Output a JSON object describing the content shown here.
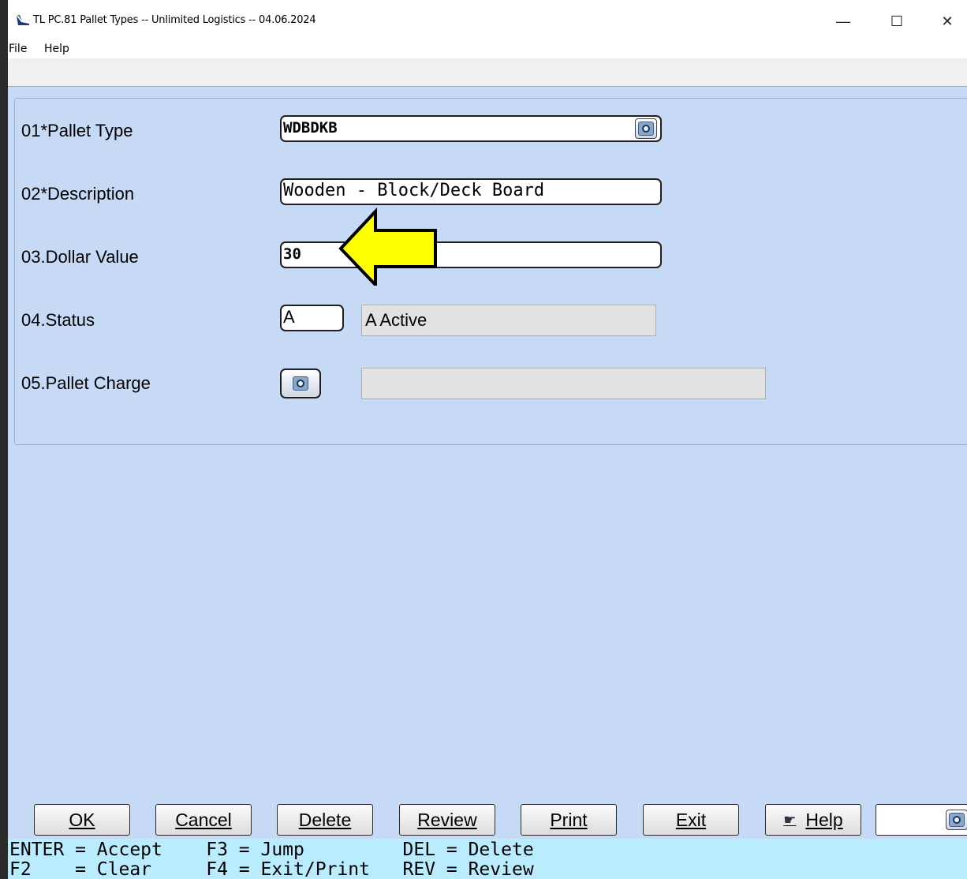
{
  "window": {
    "title": "TL PC.81 Pallet Types -- Unlimited Logistics -- 04.06.2024",
    "minimize_glyph": "—",
    "maximize_glyph": "☐",
    "close_glyph": "✕"
  },
  "menu": {
    "items": [
      "File",
      "Help"
    ]
  },
  "form": {
    "fields": [
      {
        "label": "01*Pallet Type",
        "value": "WDBDKB"
      },
      {
        "label": "02*Description",
        "value": "Wooden - Block/Deck Board"
      },
      {
        "label": "03.Dollar Value",
        "value": "30"
      },
      {
        "label": "04.Status",
        "value": "A",
        "info": "A Active"
      },
      {
        "label": "05.Pallet Charge",
        "value": "",
        "info": ""
      }
    ]
  },
  "buttons": {
    "ok": "OK",
    "cancel": "Cancel",
    "delete": "Delete",
    "review": "Review",
    "print": "Print",
    "exit": "Exit",
    "help": "Help"
  },
  "key_help": {
    "line1": "ENTER = Accept    F3 = Jump         DEL = Delete",
    "line2": "F2    = Clear     F4 = Exit/Print   REV = Review"
  },
  "colors": {
    "form_background": "#c7daf5",
    "key_help_background": "#b9ecff",
    "highlight_arrow": "#ffff00"
  },
  "icons": {
    "app": "app-logo-icon",
    "lookup": "search-icon",
    "help": "help-hand-icon"
  }
}
